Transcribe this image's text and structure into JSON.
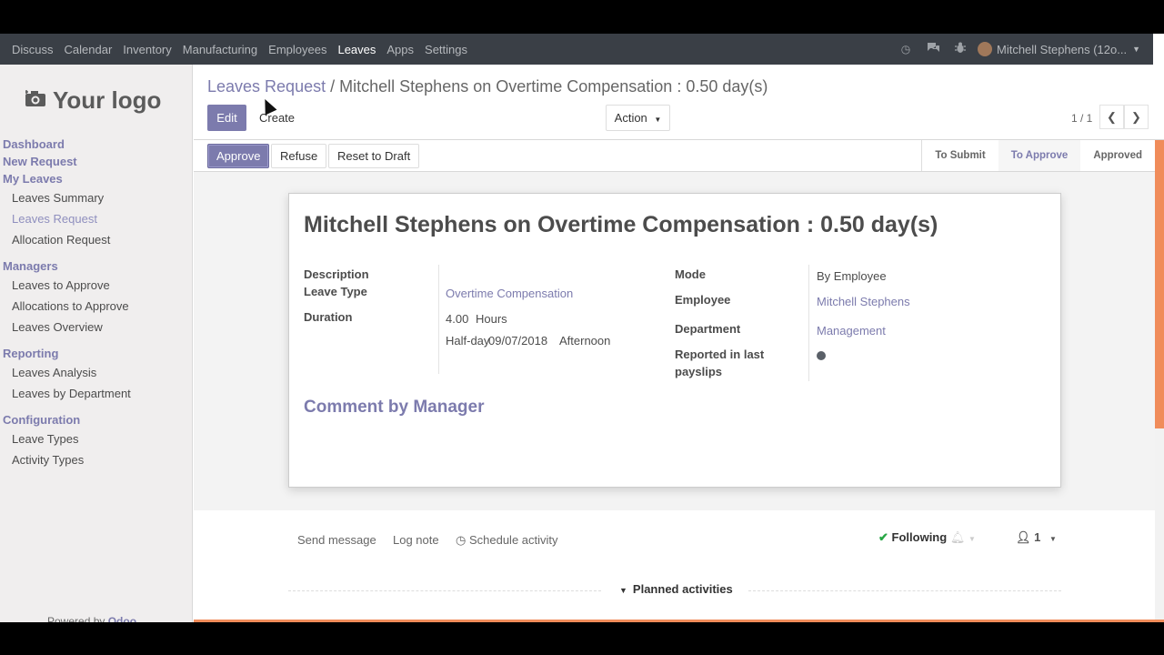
{
  "navbar": {
    "apps": [
      "Discuss",
      "Calendar",
      "Inventory",
      "Manufacturing",
      "Employees",
      "Leaves",
      "Apps",
      "Settings"
    ],
    "active_app": "Leaves",
    "user_name": "Mitchell Stephens (12o..."
  },
  "sidebar": {
    "logo_text": "Your logo",
    "top_links": [
      "Dashboard",
      "New Request",
      "My Leaves"
    ],
    "my_leaves_items": [
      "Leaves Summary",
      "Leaves Request",
      "Allocation Request"
    ],
    "managers_title": "Managers",
    "managers_items": [
      "Leaves to Approve",
      "Allocations to Approve",
      "Leaves Overview"
    ],
    "reporting_title": "Reporting",
    "reporting_items": [
      "Leaves Analysis",
      "Leaves by Department"
    ],
    "configuration_title": "Configuration",
    "configuration_items": [
      "Leave Types",
      "Activity Types"
    ],
    "powered_prefix": "Powered by",
    "powered_brand": "Odoo"
  },
  "control_panel": {
    "breadcrumb_parent": "Leaves Request",
    "breadcrumb_separator": "/",
    "breadcrumb_current": "Mitchell Stephens on Overtime Compensation : 0.50 day(s)",
    "edit_label": "Edit",
    "create_label": "Create",
    "action_label": "Action",
    "pager": "1 / 1"
  },
  "statusbar": {
    "approve_label": "Approve",
    "refuse_label": "Refuse",
    "reset_label": "Reset to Draft",
    "stages": [
      "To Submit",
      "To Approve",
      "Approved"
    ],
    "current_stage": "To Approve"
  },
  "form": {
    "title": "Mitchell Stephens on Overtime Compensation : 0.50 day(s)",
    "description_label": "Description",
    "leave_type_label": "Leave Type",
    "leave_type_value": "Overtime Compensation",
    "duration_label": "Duration",
    "duration_amount": "4.00",
    "duration_unit": "Hours",
    "half_day_label": "Half-day",
    "half_day_date": "09/07/2018",
    "half_day_period": "Afternoon",
    "mode_label": "Mode",
    "mode_value": "By Employee",
    "employee_label": "Employee",
    "employee_value": "Mitchell Stephens",
    "department_label": "Department",
    "department_value": "Management",
    "reported_label_1": "Reported in last",
    "reported_label_2": "payslips",
    "comment_title": "Comment by Manager"
  },
  "chatter": {
    "send_message": "Send message",
    "log_note": "Log note",
    "schedule_activity": "Schedule activity",
    "following_label": "Following",
    "followers_count": "1",
    "planned_activities": "Planned activities"
  }
}
